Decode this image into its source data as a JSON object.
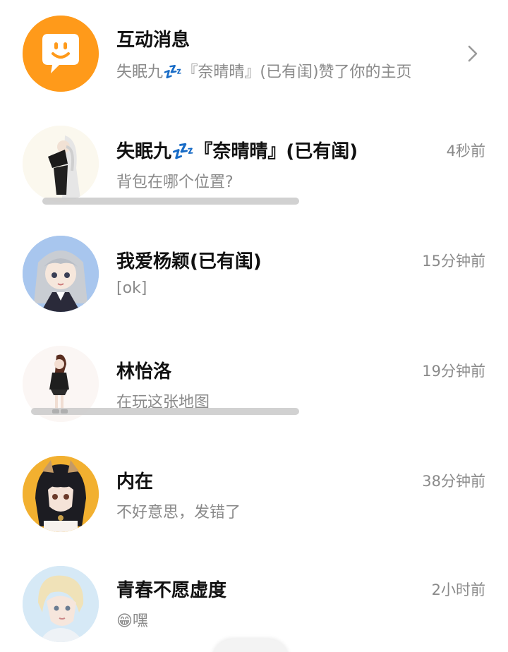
{
  "interactive": {
    "title": "互动消息",
    "preview": "失眠九💤『奈晴晴』(已有闺)赞了你的主页",
    "icon": "smiley-chat-icon"
  },
  "chats": [
    {
      "name": "失眠九💤『奈晴晴』(已有闺)",
      "message": "背包在哪个位置?",
      "time": "4秒前"
    },
    {
      "name": "我爱杨颖(已有闺)",
      "message": "[ok]",
      "time": "15分钟前"
    },
    {
      "name": "林怡洛",
      "message": "在玩这张地图",
      "time": "19分钟前"
    },
    {
      "name": "内在",
      "message": "不好意思，发错了",
      "time": "38分钟前"
    },
    {
      "name": "青春不愿虚度",
      "message": "😁嘿",
      "time": "2小时前"
    }
  ],
  "colors": {
    "accent": "#FF9A1A",
    "text_primary": "#111111",
    "text_secondary": "#8A8A8A"
  }
}
